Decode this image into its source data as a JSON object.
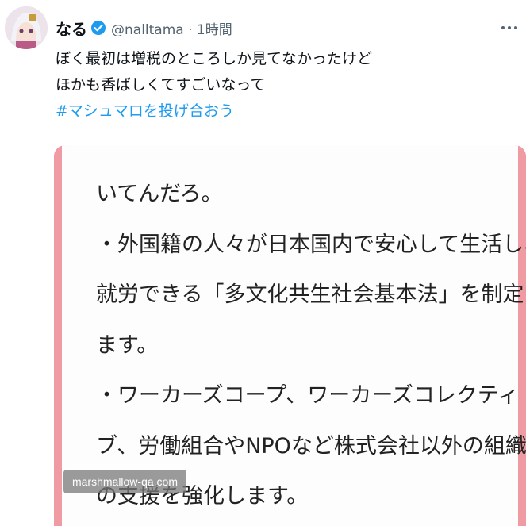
{
  "tweet": {
    "author_name": "なる",
    "handle_time": "@nalltama · 1時間",
    "lines": [
      "ぼく最初は増税のところしか見てなかったけど",
      "ほかも香ばしくてすごいなって"
    ],
    "hashtag": "#マシュマロを投げ合おう"
  },
  "card": {
    "lines": [
      "いてんだろ。",
      "・外国籍の人々が日本国内で安心して生活し、",
      "就労できる「多文化共生社会基本法」を制定し",
      "ます。",
      "・ワーカーズコープ、ワーカーズコレクティ",
      "ブ、労働組合やNPOなど株式会社以外の組織へ",
      "の支援を強化します。"
    ],
    "watermark": "marshmallow-qa.com"
  },
  "colors": {
    "accent": "#1d9bf0",
    "card_border": "#f09aa3"
  },
  "icons": {
    "verified": "verified-badge-icon",
    "more": "more-options-icon"
  }
}
